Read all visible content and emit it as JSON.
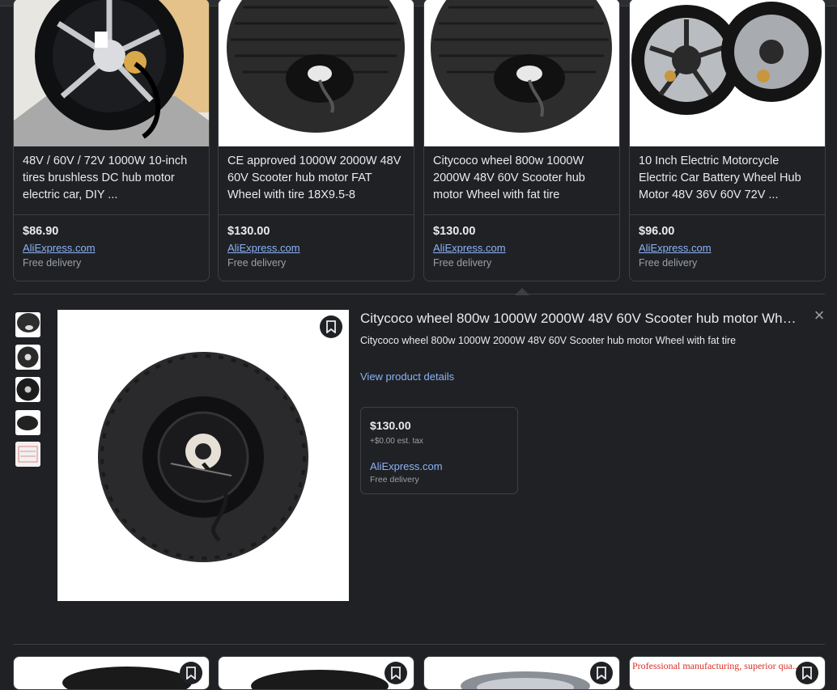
{
  "results": [
    {
      "title": "48V / 60V / 72V 1000W 10-inch tires brushless DC hub motor electric car, DIY ...",
      "price": "$86.90",
      "store": "AliExpress.com",
      "delivery": "Free delivery"
    },
    {
      "title": "CE approved 1000W 2000W 48V 60V Scooter hub motor FAT Wheel with tire 18X9.5-8",
      "price": "$130.00",
      "store": "AliExpress.com",
      "delivery": "Free delivery"
    },
    {
      "title": "Citycoco wheel 800w 1000W 2000W 48V 60V Scooter hub motor Wheel with fat tire",
      "price": "$130.00",
      "store": "AliExpress.com",
      "delivery": "Free delivery"
    },
    {
      "title": "10 Inch Electric Motorcycle Electric Car Battery Wheel Hub Motor 48V 36V 60V 72V ...",
      "price": "$96.00",
      "store": "AliExpress.com",
      "delivery": "Free delivery"
    }
  ],
  "detail": {
    "title": "Citycoco wheel 800w 1000W 2000W 48V 60V Scooter hub motor Whee...",
    "description": "Citycoco wheel 800w 1000W 2000W 48V 60V Scooter hub motor Wheel with fat tire",
    "view_link": "View product details",
    "close_icon": "close-icon",
    "offer": {
      "price": "$130.00",
      "tax": "+$0.00 est. tax",
      "store": "AliExpress.com",
      "delivery": "Free delivery"
    }
  },
  "bottom_row": {
    "promo_text": "Professional manufacturing, superior qua..."
  },
  "icons": {
    "save": "bookmark-icon",
    "close": "close-icon"
  },
  "colors": {
    "background": "#202124",
    "border": "#3c4043",
    "link": "#8ab4f8",
    "text": "#e8eaed",
    "muted": "#9aa0a6"
  }
}
